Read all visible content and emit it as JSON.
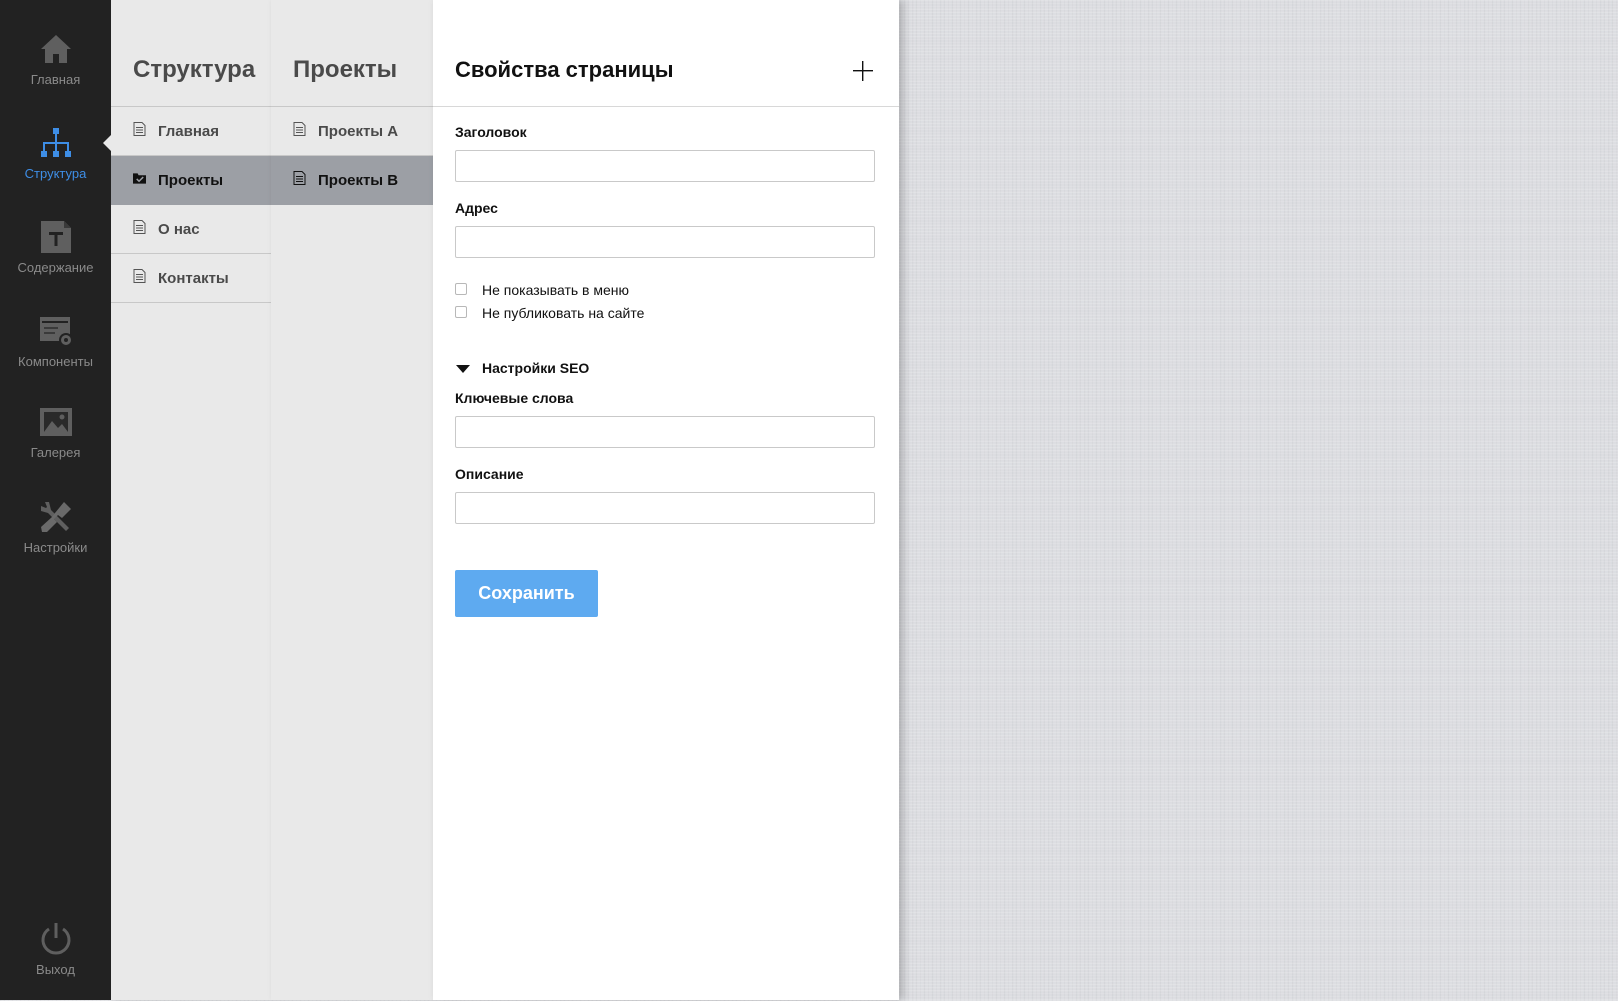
{
  "sidebar": {
    "items": [
      {
        "label": "Главная",
        "icon": "home-icon"
      },
      {
        "label": "Структура",
        "icon": "sitemap-icon",
        "active": true
      },
      {
        "label": "Содержание",
        "icon": "text-page-icon"
      },
      {
        "label": "Компоненты",
        "icon": "components-icon"
      },
      {
        "label": "Галерея",
        "icon": "gallery-icon"
      },
      {
        "label": "Настройки",
        "icon": "tools-icon"
      }
    ],
    "logout": {
      "label": "Выход",
      "icon": "power-icon"
    },
    "active_color": "#3e8ee6",
    "background": "#222222"
  },
  "structure": {
    "title": "Структура",
    "items": [
      {
        "label": "Главная",
        "icon": "document-icon"
      },
      {
        "label": "Проекты",
        "icon": "folder-check-icon",
        "selected": true
      },
      {
        "label": "О нас",
        "icon": "document-icon"
      },
      {
        "label": "Контакты",
        "icon": "document-icon"
      }
    ]
  },
  "projects": {
    "title": "Проекты",
    "items": [
      {
        "label": "Проекты А",
        "icon": "document-icon"
      },
      {
        "label": "Проекты B",
        "icon": "document-icon",
        "selected": true
      }
    ]
  },
  "page_properties": {
    "title": "Свойства страницы",
    "add_icon": "plus-icon",
    "fields": {
      "title_label": "Заголовок",
      "title_value": "",
      "address_label": "Адрес",
      "address_value": ""
    },
    "checkboxes": {
      "hide_in_menu": "Не показывать в меню",
      "hide_in_menu_checked": false,
      "unpublish": "Не публиковать на сайте",
      "unpublish_checked": false
    },
    "seo": {
      "toggle_label": "Настройки SEO",
      "expanded": true,
      "keywords_label": "Ключевые слова",
      "keywords_value": "",
      "description_label": "Описание",
      "description_value": ""
    },
    "save_label": "Сохранить",
    "save_color": "#5eaaf0"
  }
}
